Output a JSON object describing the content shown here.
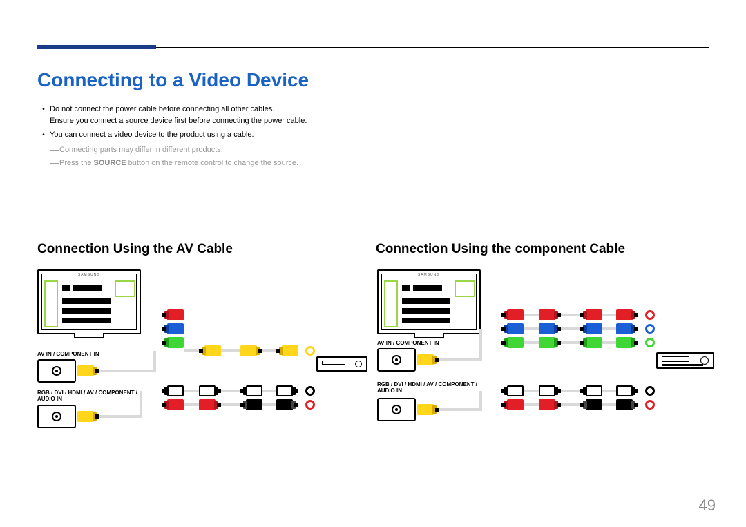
{
  "page_number": "49",
  "main_title": "Connecting to a Video Device",
  "bullets": {
    "b1_line1": "Do not connect the power cable before connecting all other cables.",
    "b1_line2": "Ensure you connect a source device first before connecting the power cable.",
    "b2": "You can connect a video device to the product using a cable."
  },
  "notes": {
    "n1": "Connecting parts may differ in different products.",
    "n2_pre": "Press the ",
    "n2_bold": "SOURCE",
    "n2_post": " button on the remote control to change the source."
  },
  "sub_left": "Connection Using the AV Cable",
  "sub_right": "Connection Using the component Cable",
  "port_labels": {
    "av_in": "AV IN / COMPONENT IN",
    "audio_in": "RGB / DVI / HDMI / AV / COMPONENT / AUDIO IN"
  },
  "monitor_brand": "SAMSUNG",
  "diagram_left": {
    "video_plugs_source": [
      "red",
      "blue",
      "green"
    ],
    "video_cable_run": [
      "yellow"
    ],
    "audio_plugs_source": [
      "yellow"
    ],
    "audio_cable_run": [
      "white",
      "red"
    ],
    "targets_top": [
      "yellow"
    ],
    "targets_bottom": [
      "white",
      "red"
    ]
  },
  "diagram_right": {
    "video_plugs_source": [
      "red",
      "blue",
      "green"
    ],
    "video_cable_run": [
      "red",
      "blue",
      "green"
    ],
    "audio_plugs_source": [
      "yellow"
    ],
    "audio_cable_run": [
      "white",
      "red"
    ],
    "targets_top": [
      "red",
      "blue",
      "green"
    ],
    "targets_bottom": [
      "white",
      "red"
    ]
  }
}
